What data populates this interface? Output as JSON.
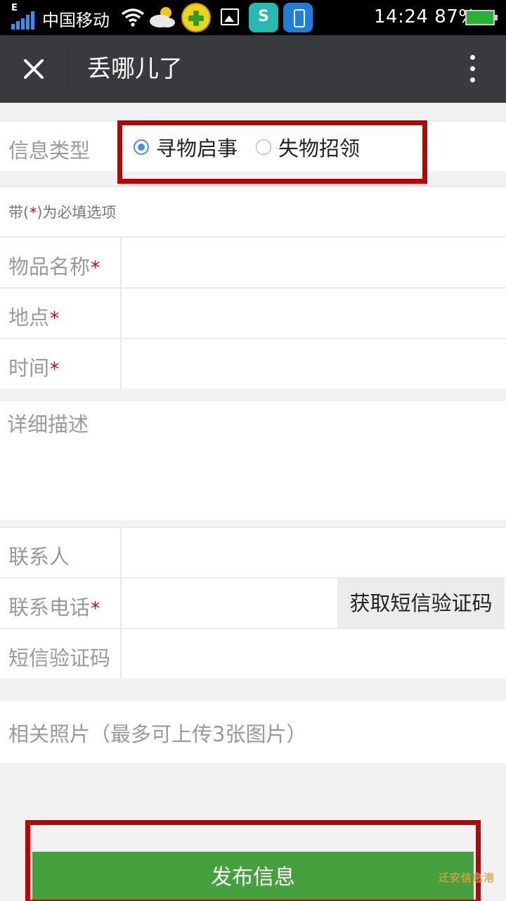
{
  "status_bar": {
    "network": "E",
    "carrier": "中国移动",
    "time": "14:24",
    "battery": "87%",
    "icons": [
      "signal-icon",
      "wifi-icon",
      "weather-icon",
      "app-icon",
      "image-icon",
      "security-app-icon",
      "cleaner-app-icon",
      "battery-icon"
    ]
  },
  "header": {
    "title": "丢哪儿了",
    "close_icon": "close-icon",
    "more_icon": "more-vertical-icon"
  },
  "form": {
    "info_type": {
      "label": "信息类型",
      "options": [
        {
          "label": "寻物启事",
          "checked": true
        },
        {
          "label": "失物招领",
          "checked": false
        }
      ]
    },
    "hint_prefix": "带(",
    "hint_star": "*",
    "hint_suffix": ")为必填选项",
    "required_mark": "*",
    "item_name": {
      "label": "物品名称",
      "value": ""
    },
    "location": {
      "label": "地点",
      "value": ""
    },
    "time": {
      "label": "时间",
      "value": ""
    },
    "description": {
      "placeholder": "详细描述",
      "value": ""
    },
    "contact_person": {
      "label": "联系人",
      "value": ""
    },
    "phone": {
      "label": "联系电话",
      "value": "",
      "sms_button": "获取短信验证码"
    },
    "sms_code": {
      "label": "短信验证码",
      "value": ""
    },
    "photos": {
      "label": "相关照片（最多可上传3张图片）"
    },
    "submit": "发布信息"
  },
  "watermark": "迁安信息港",
  "colors": {
    "header_bg": "#393a3e",
    "submit_bg": "#44a13e",
    "highlight": "#c00000",
    "radio_accent": "#4a90e2",
    "required": "#d0021b"
  }
}
